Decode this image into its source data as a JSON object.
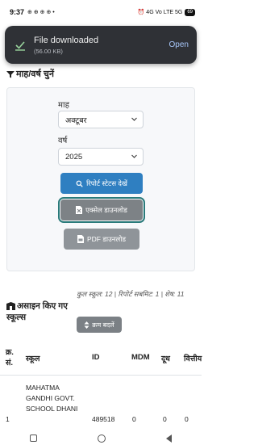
{
  "status_bar": {
    "time": "9:37",
    "icons_left": "⊕ ⊕ ⊕ ⊕ •",
    "icons_right": "⏰ 4G Vo LTE 5G",
    "battery": "69"
  },
  "toast": {
    "title": "File downloaded",
    "subtitle": "(56.00 KB)",
    "action": "Open"
  },
  "filter": {
    "heading": "माह/वर्ष चुनें",
    "month_label": "माह",
    "month_value": "अक्टूबर",
    "year_label": "वर्ष",
    "year_value": "2025",
    "btn_status": "रिपोर्ट स्टेटस देखें",
    "btn_excel": "एक्सेल डाउनलोड",
    "btn_pdf": "PDF डाउनलोड"
  },
  "assigned": {
    "heading": "असाइन किए गए स्कूल्स",
    "stats": "कुल स्कूल: 12 | रिपोर्ट सबमिट: 1 | शेष: 11",
    "order_btn": "क्रम बदलें"
  },
  "table": {
    "headers": [
      "क्र. सं.",
      "स्कूल",
      "ID",
      "MDM",
      "दूध",
      "वित्तीय"
    ],
    "rows": [
      {
        "sn": "1",
        "school": "MAHATMA GANDHI GOVT. SCHOOL DHANI",
        "id": "489518",
        "mdm": "0",
        "milk": "0",
        "fin": "0"
      }
    ]
  }
}
